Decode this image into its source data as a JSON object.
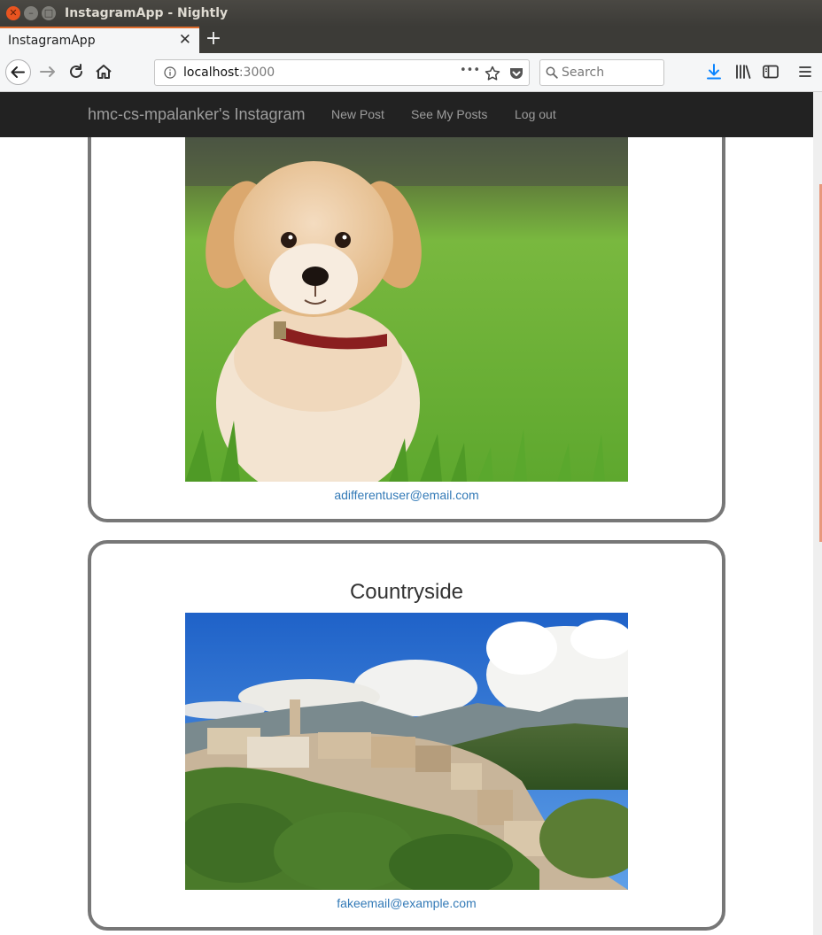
{
  "window": {
    "title": "InstagramApp - Nightly"
  },
  "tab": {
    "title": "InstagramApp",
    "close": "✕",
    "new_tab": "+"
  },
  "urlbar": {
    "host": "localhost",
    "port": ":3000",
    "more": "•••"
  },
  "search": {
    "placeholder": "Search"
  },
  "site_nav": {
    "brand": "hmc-cs-mpalanker's Instagram",
    "links": [
      "New Post",
      "See My Posts",
      "Log out"
    ]
  },
  "posts": [
    {
      "title": "",
      "image": "golden-retriever-puppy-in-grass",
      "author": "adifferentuser@email.com"
    },
    {
      "title": "Countryside",
      "image": "hilltop-village-countryside",
      "author": "fakeemail@example.com"
    }
  ],
  "colors": {
    "nav_bg": "#222222",
    "link": "#337ab7",
    "card_border": "#777777",
    "accent": "#e95420"
  }
}
